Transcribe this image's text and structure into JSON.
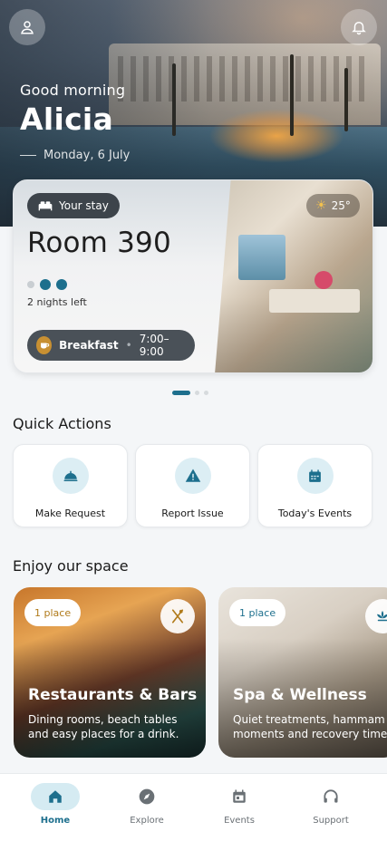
{
  "hero": {
    "greeting": "Good morning",
    "name": "Alicia",
    "date": "Monday, 6 July"
  },
  "stay": {
    "badge": "Your stay",
    "room": "Room 390",
    "nights_left": "2 nights left",
    "weather_icon": "sun-icon",
    "temperature": "25°",
    "breakfast_label": "Breakfast",
    "breakfast_time": "7:00–9:00",
    "nights_total": 3,
    "nights_remaining": 2
  },
  "carousel": {
    "pages": 3,
    "active": 0
  },
  "quick_actions": {
    "title": "Quick Actions",
    "items": [
      {
        "label": "Make Request",
        "icon": "service-bell-icon"
      },
      {
        "label": "Report Issue",
        "icon": "warning-icon"
      },
      {
        "label": "Today's Events",
        "icon": "calendar-icon"
      }
    ]
  },
  "spaces": {
    "title": "Enjoy our space",
    "items": [
      {
        "badge": "1 place",
        "title": "Restaurants & Bars",
        "desc1": "Dining rooms, beach tables",
        "desc2": "and easy places for a drink.",
        "icon": "utensils-icon"
      },
      {
        "badge": "1 place",
        "title": "Spa & Wellness",
        "desc1": "Quiet treatments, hammam",
        "desc2": "moments and recovery time",
        "icon": "lotus-icon"
      }
    ]
  },
  "nav": {
    "items": [
      {
        "label": "Home",
        "icon": "home-icon",
        "active": true
      },
      {
        "label": "Explore",
        "icon": "compass-icon",
        "active": false
      },
      {
        "label": "Events",
        "icon": "calendar-icon",
        "active": false
      },
      {
        "label": "Support",
        "icon": "headset-icon",
        "active": false
      }
    ]
  },
  "colors": {
    "accent": "#1d6f8d",
    "accent_light": "#dceef4",
    "badge_text": "#b07a1a",
    "spa_badge_text": "#1d6f8d"
  }
}
